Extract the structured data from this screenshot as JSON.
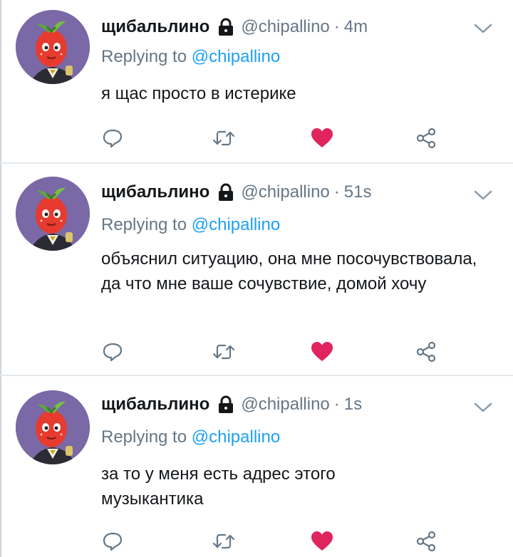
{
  "colors": {
    "name": "#14171a",
    "meta": "#657786",
    "link": "#1da1f2",
    "like": "#e0245e",
    "divider": "#e1e8ed",
    "icon": "#8899a6"
  },
  "icons": [
    "lock-icon",
    "chevron-down-icon",
    "reply-icon",
    "retweet-icon",
    "heart-icon",
    "share-icon"
  ],
  "tweets": [
    {
      "display_name": "щибальлино",
      "handle": "@chipallino",
      "separator": "·",
      "time": "4m",
      "replying_prefix": "Replying to",
      "replying_handle": "@chipallino",
      "text": "я щас просто в истерике",
      "liked": true
    },
    {
      "display_name": "щибальлино",
      "handle": "@chipallino",
      "separator": "·",
      "time": "51s",
      "replying_prefix": "Replying to",
      "replying_handle": "@chipallino",
      "text": "объяснил ситуацию, она мне посочувствовала, да что мне ваше сочувствие, домой хочу",
      "liked": true
    },
    {
      "display_name": "щибальлино",
      "handle": "@chipallino",
      "separator": "·",
      "time": "1s",
      "replying_prefix": "Replying to",
      "replying_handle": "@chipallino",
      "text": "за то у меня есть адрес этого музыкантика",
      "liked": true
    }
  ]
}
